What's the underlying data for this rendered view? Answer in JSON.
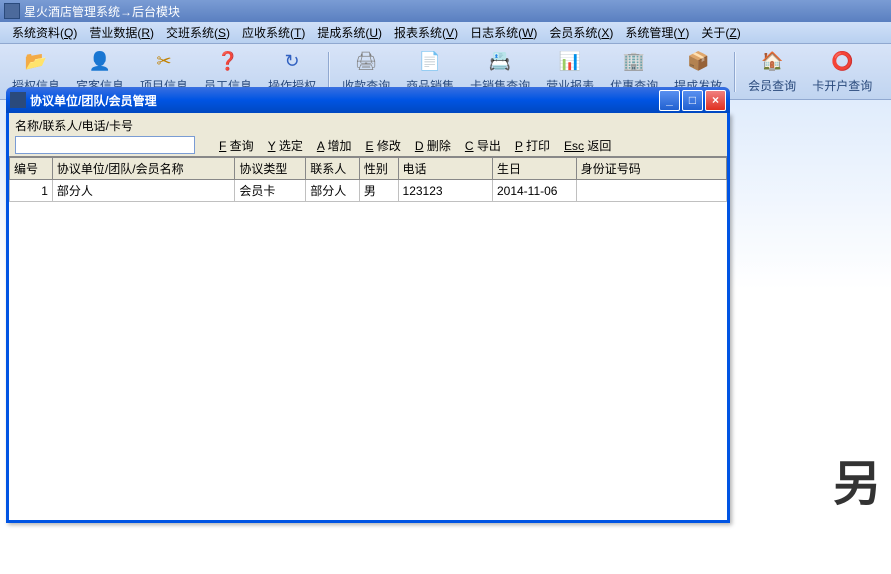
{
  "main_title": "星火酒店管理系统→后台模块",
  "menus": [
    {
      "label": "系统资料",
      "key": "Q"
    },
    {
      "label": "营业数据",
      "key": "R"
    },
    {
      "label": "交班系统",
      "key": "S"
    },
    {
      "label": "应收系统",
      "key": "T"
    },
    {
      "label": "提成系统",
      "key": "U"
    },
    {
      "label": "报表系统",
      "key": "V"
    },
    {
      "label": "日志系统",
      "key": "W"
    },
    {
      "label": "会员系统",
      "key": "X"
    },
    {
      "label": "系统管理",
      "key": "Y"
    },
    {
      "label": "关于",
      "key": "Z"
    }
  ],
  "toolbar": [
    {
      "glyph": "📂",
      "color": "#e0c030",
      "label": "授权信息"
    },
    {
      "glyph": "👤",
      "color": "#3060c0",
      "label": "宾客信息"
    },
    {
      "glyph": "✂",
      "color": "#c08000",
      "label": "项目信息"
    },
    {
      "glyph": "❓",
      "color": "#30a030",
      "label": "员工信息"
    },
    {
      "glyph": "↻",
      "color": "#3060c0",
      "label": "操作授权"
    },
    {
      "glyph": "🖨",
      "color": "#808080",
      "label": "收款查询"
    },
    {
      "glyph": "📄",
      "color": "#808080",
      "label": "商品销售"
    },
    {
      "glyph": "📇",
      "color": "#c04040",
      "label": "卡销售查询"
    },
    {
      "glyph": "📊",
      "color": "#c08000",
      "label": "营业报表"
    },
    {
      "glyph": "🏢",
      "color": "#3060c0",
      "label": "优惠查询"
    },
    {
      "glyph": "📦",
      "color": "#c08000",
      "label": "提成发放"
    },
    {
      "glyph": "🏠",
      "color": "#e07020",
      "label": "会员查询"
    },
    {
      "glyph": "⭕",
      "color": "#3060c0",
      "label": "卡开户查询"
    }
  ],
  "toolbar_sep_after": [
    4,
    10
  ],
  "child": {
    "title": "协议单位/团队/会员管理",
    "search_label": "名称/联系人/电话/卡号",
    "search_value": "",
    "actions": [
      {
        "key": "F",
        "label": "查询"
      },
      {
        "key": "Y",
        "label": "选定"
      },
      {
        "key": "A",
        "label": "增加"
      },
      {
        "key": "E",
        "label": "修改"
      },
      {
        "key": "D",
        "label": "删除"
      },
      {
        "key": "C",
        "label": "导出"
      },
      {
        "key": "P",
        "label": "打印"
      },
      {
        "key": "Esc",
        "label": "返回"
      }
    ],
    "columns": [
      "编号",
      "协议单位/团队/会员名称",
      "协议类型",
      "联系人",
      "性别",
      "电话",
      "生日",
      "身份证号码"
    ],
    "rows": [
      {
        "id": "1",
        "name": "部分人",
        "type": "会员卡",
        "contact": "部分人",
        "gender": "男",
        "phone": "123123",
        "birthday": "2014-11-06",
        "idcard": ""
      }
    ]
  },
  "bg_text": "另"
}
